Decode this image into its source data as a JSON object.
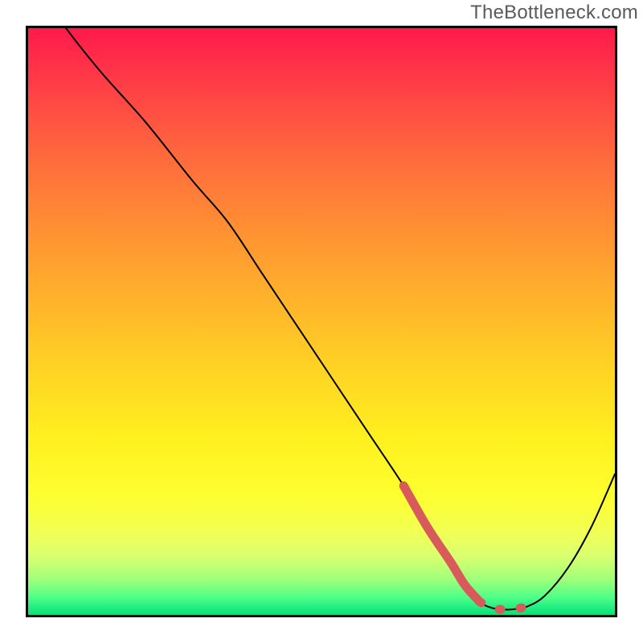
{
  "watermark": "TheBottleneck.com",
  "chart_data": {
    "type": "line",
    "title": "",
    "xlabel": "",
    "ylabel": "",
    "xlim": [
      0,
      100
    ],
    "ylim": [
      0,
      100
    ],
    "series": [
      {
        "name": "curve-main",
        "x": [
          0,
          5,
          12,
          20,
          28,
          34,
          40,
          46,
          52,
          58,
          64,
          68,
          72,
          74.5,
          77,
          79,
          81,
          83,
          85,
          88,
          92,
          96,
          100
        ],
        "values": [
          110,
          102,
          93,
          84,
          74,
          67,
          58,
          49,
          40,
          31,
          22,
          15,
          9,
          5,
          2.2,
          1.2,
          0.9,
          1.0,
          1.4,
          3.2,
          8,
          15,
          24
        ]
      },
      {
        "name": "curve-highlight",
        "x": [
          64,
          68,
          72,
          74.5,
          77,
          79,
          81,
          83,
          85
        ],
        "values": [
          22,
          15,
          9,
          5,
          2.2,
          1.2,
          0.9,
          1.0,
          1.4
        ]
      }
    ],
    "gradient_stops": [
      {
        "pos": 0,
        "color": "#ff1a4b"
      },
      {
        "pos": 10,
        "color": "#ff3f46"
      },
      {
        "pos": 22,
        "color": "#ff6a3d"
      },
      {
        "pos": 34,
        "color": "#ff8f33"
      },
      {
        "pos": 46,
        "color": "#ffb22b"
      },
      {
        "pos": 58,
        "color": "#ffd324"
      },
      {
        "pos": 70,
        "color": "#fff01f"
      },
      {
        "pos": 80,
        "color": "#fdff30"
      },
      {
        "pos": 86,
        "color": "#f1ff55"
      },
      {
        "pos": 90,
        "color": "#d9ff70"
      },
      {
        "pos": 94,
        "color": "#9eff7a"
      },
      {
        "pos": 97,
        "color": "#4fff88"
      },
      {
        "pos": 100,
        "color": "#04e27a"
      }
    ],
    "highlight_color": "#d85a5a",
    "curve_color": "#000000"
  }
}
